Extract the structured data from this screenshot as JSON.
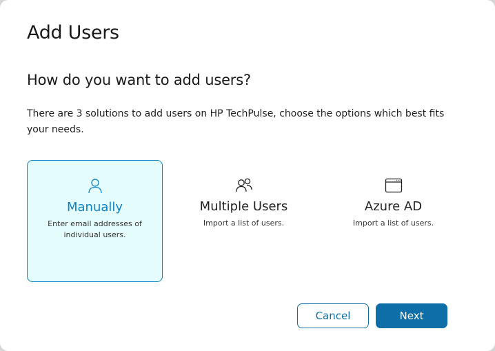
{
  "dialog": {
    "title": "Add Users",
    "subtitle": "How do you want to add users?",
    "description": "There are 3 solutions to add users on HP TechPulse, choose the options which best fits your needs."
  },
  "options": [
    {
      "label": "Manually",
      "description": "Enter email addresses of individual users.",
      "icon": "user-icon",
      "selected": true
    },
    {
      "label": "Multiple Users",
      "description": "Import a list of users.",
      "icon": "users-group-icon",
      "selected": false
    },
    {
      "label": "Azure AD",
      "description": "Import a list of users.",
      "icon": "browser-window-icon",
      "selected": false
    }
  ],
  "buttons": {
    "cancel_label": "Cancel",
    "next_label": "Next"
  },
  "colors": {
    "accent": "#0e83c8",
    "primary_button": "#0e6fa8",
    "selected_bg": "#e5fcfc"
  }
}
